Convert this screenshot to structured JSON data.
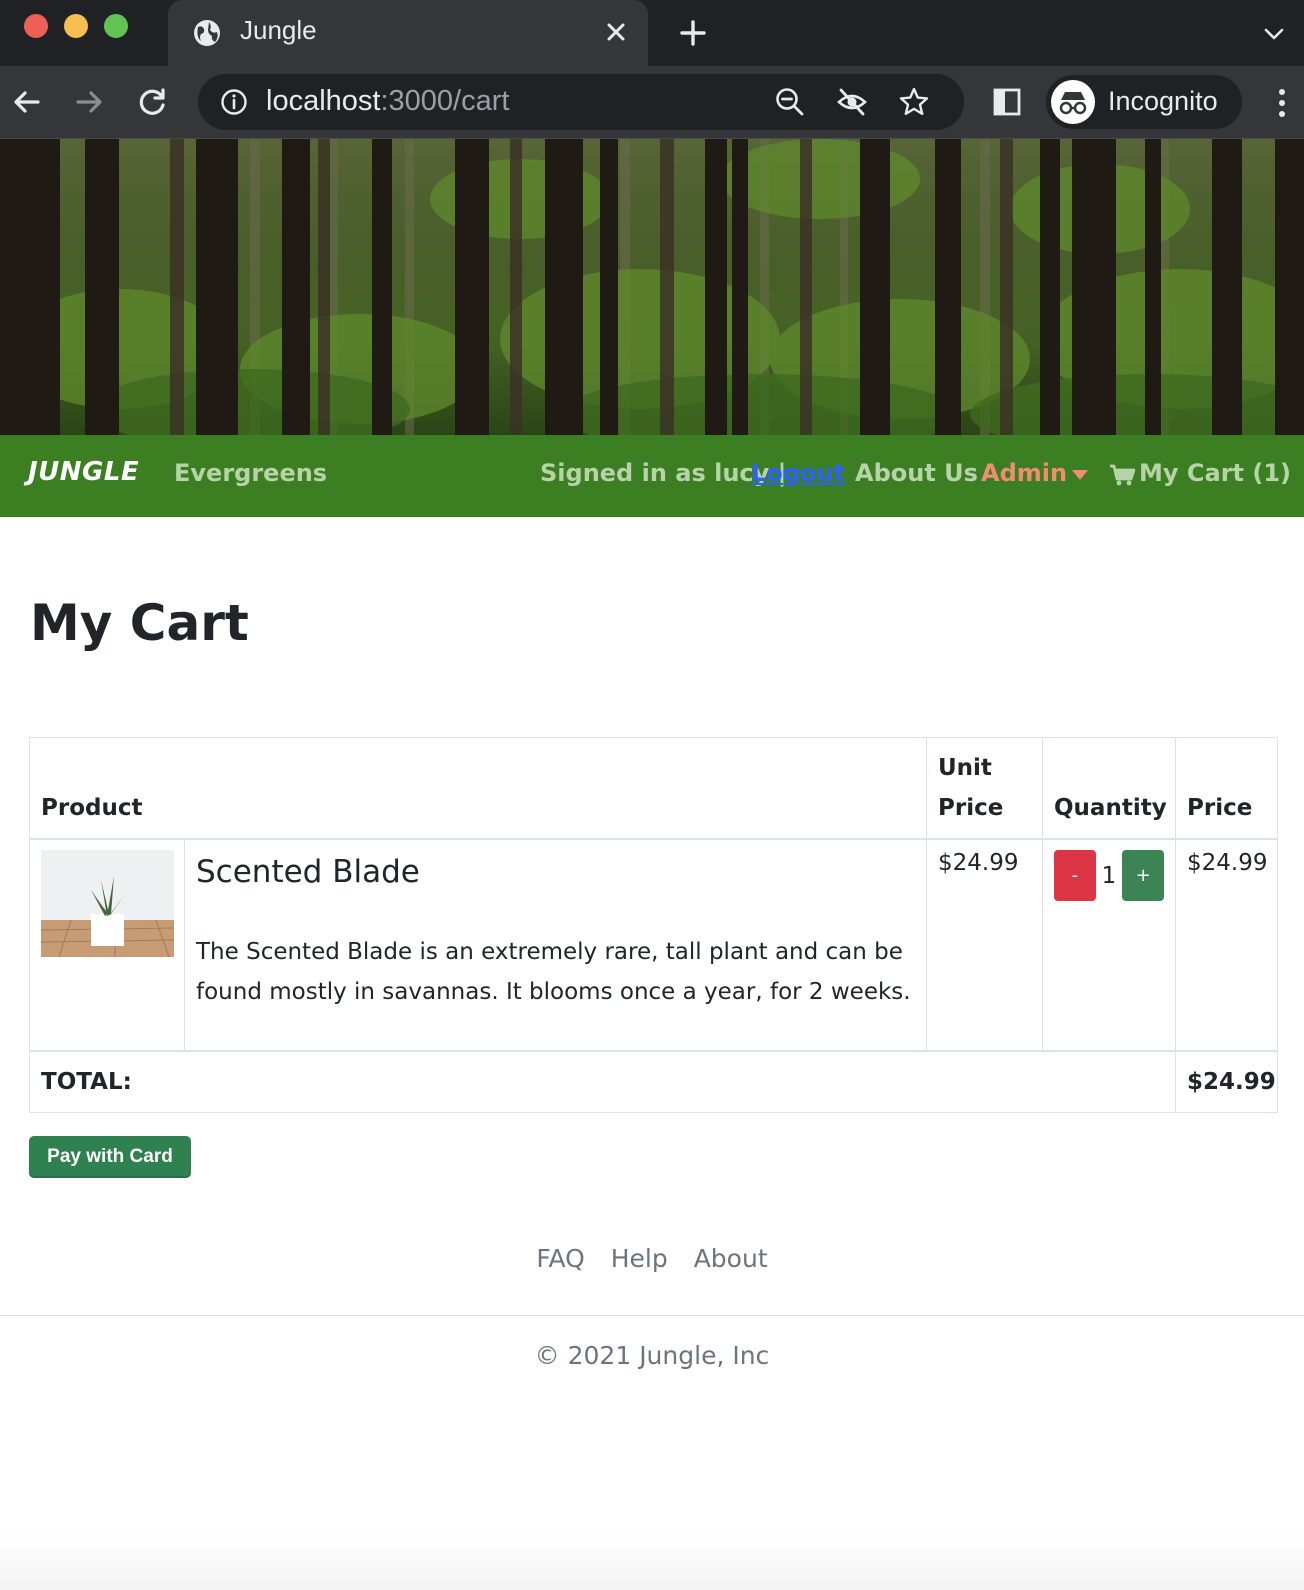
{
  "browser": {
    "tab_title": "Jungle",
    "url_host": "localhost",
    "url_path": ":3000/cart",
    "profile_label": "Incognito"
  },
  "navbar": {
    "brand": "JUNGLE",
    "category": "Evergreens",
    "signed_in": "Signed in as lucy |",
    "logout": "Logout",
    "about": "About Us",
    "admin": "Admin",
    "cart": "My Cart (1)"
  },
  "page": {
    "title": "My Cart"
  },
  "table": {
    "headers": {
      "product": "Product",
      "unit_price": "Unit Price",
      "quantity": "Quantity",
      "price": "Price"
    },
    "items": [
      {
        "name": "Scented Blade",
        "description": "The Scented Blade is an extremely rare, tall plant and can be found mostly in savannas. It blooms once a year, for 2 weeks.",
        "unit_price": "$24.99",
        "quantity": "1",
        "minus_label": "-",
        "plus_label": "+",
        "price": "$24.99"
      }
    ],
    "total_label": "TOTAL:",
    "total_value": "$24.99"
  },
  "pay_button": "Pay with Card",
  "footer": {
    "links": [
      "FAQ",
      "Help",
      "About"
    ],
    "copyright": "© 2021 Jungle, Inc"
  },
  "colors": {
    "navbar_bg": "#3c7f22",
    "navbar_link": "#b7d3a8",
    "logout_link": "#2b62ff",
    "admin_link": "#f08c73",
    "minus_button": "#dc3545",
    "plus_button": "#3c8454",
    "pay_button": "#2f8150"
  }
}
